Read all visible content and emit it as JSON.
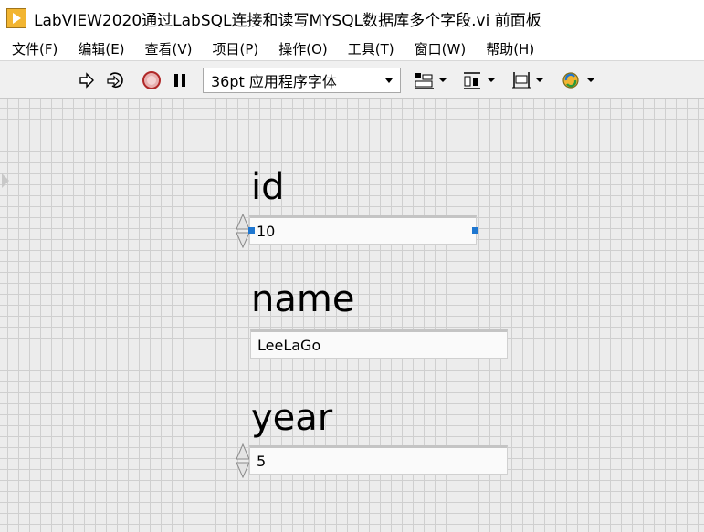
{
  "window": {
    "title": "LabVIEW2020通过LabSQL连接和读写MYSQL数据库多个字段.vi 前面板"
  },
  "menu": [
    "文件(F)",
    "编辑(E)",
    "查看(V)",
    "项目(P)",
    "操作(O)",
    "工具(T)",
    "窗口(W)",
    "帮助(H)"
  ],
  "toolbar": {
    "font_select": "36pt 应用程序字体"
  },
  "controls": {
    "id": {
      "label": "id",
      "value": "10"
    },
    "name": {
      "label": "name",
      "value": "LeeLaGo"
    },
    "year": {
      "label": "year",
      "value": "5"
    }
  },
  "colors": {
    "accent": "#f2b531",
    "selection": "#1f77d0",
    "grid": "#cfcfcf",
    "panel": "#ececec"
  }
}
